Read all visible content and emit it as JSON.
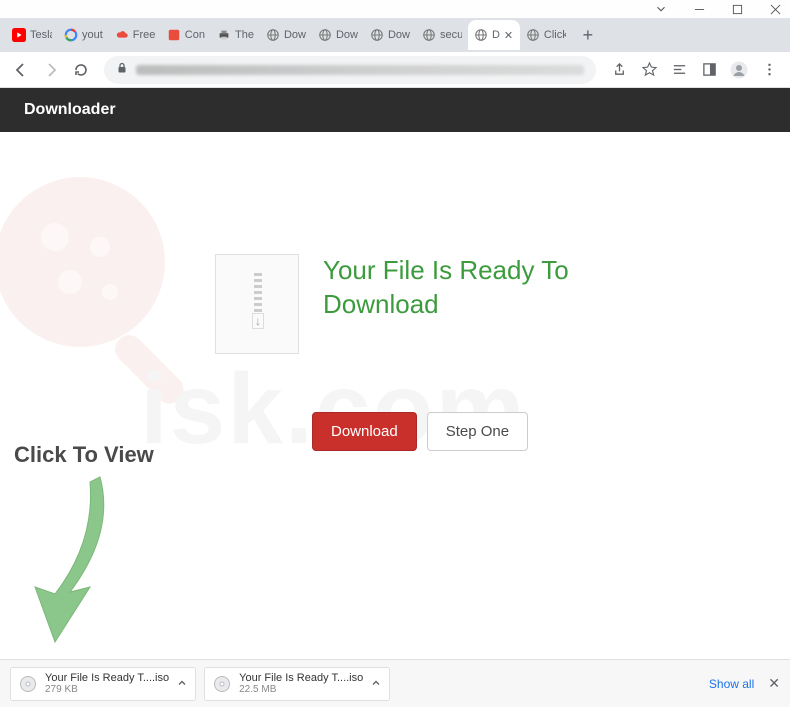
{
  "window": {
    "tabs": [
      {
        "title": "Tesla",
        "favicon": "youtube"
      },
      {
        "title": "yout",
        "favicon": "google"
      },
      {
        "title": "Free",
        "favicon": "red-cloud"
      },
      {
        "title": "Con",
        "favicon": "red-square"
      },
      {
        "title": "The",
        "favicon": "printer"
      },
      {
        "title": "Dow",
        "favicon": "globe"
      },
      {
        "title": "Dow",
        "favicon": "globe"
      },
      {
        "title": "Dow",
        "favicon": "globe"
      },
      {
        "title": "secu",
        "favicon": "globe"
      },
      {
        "title": "D",
        "favicon": "globe",
        "active": true
      },
      {
        "title": "Click",
        "favicon": "globe"
      }
    ]
  },
  "page": {
    "header_title": "Downloader",
    "headline": "Your File Is Ready To Download",
    "download_btn": "Download",
    "step_btn": "Step One",
    "click_hint": "Click To View"
  },
  "downloads": {
    "items": [
      {
        "name": "Your File Is Ready T....iso",
        "size": "279 KB"
      },
      {
        "name": "Your File Is Ready T....iso",
        "size": "22.5 MB"
      }
    ],
    "show_all": "Show all"
  }
}
